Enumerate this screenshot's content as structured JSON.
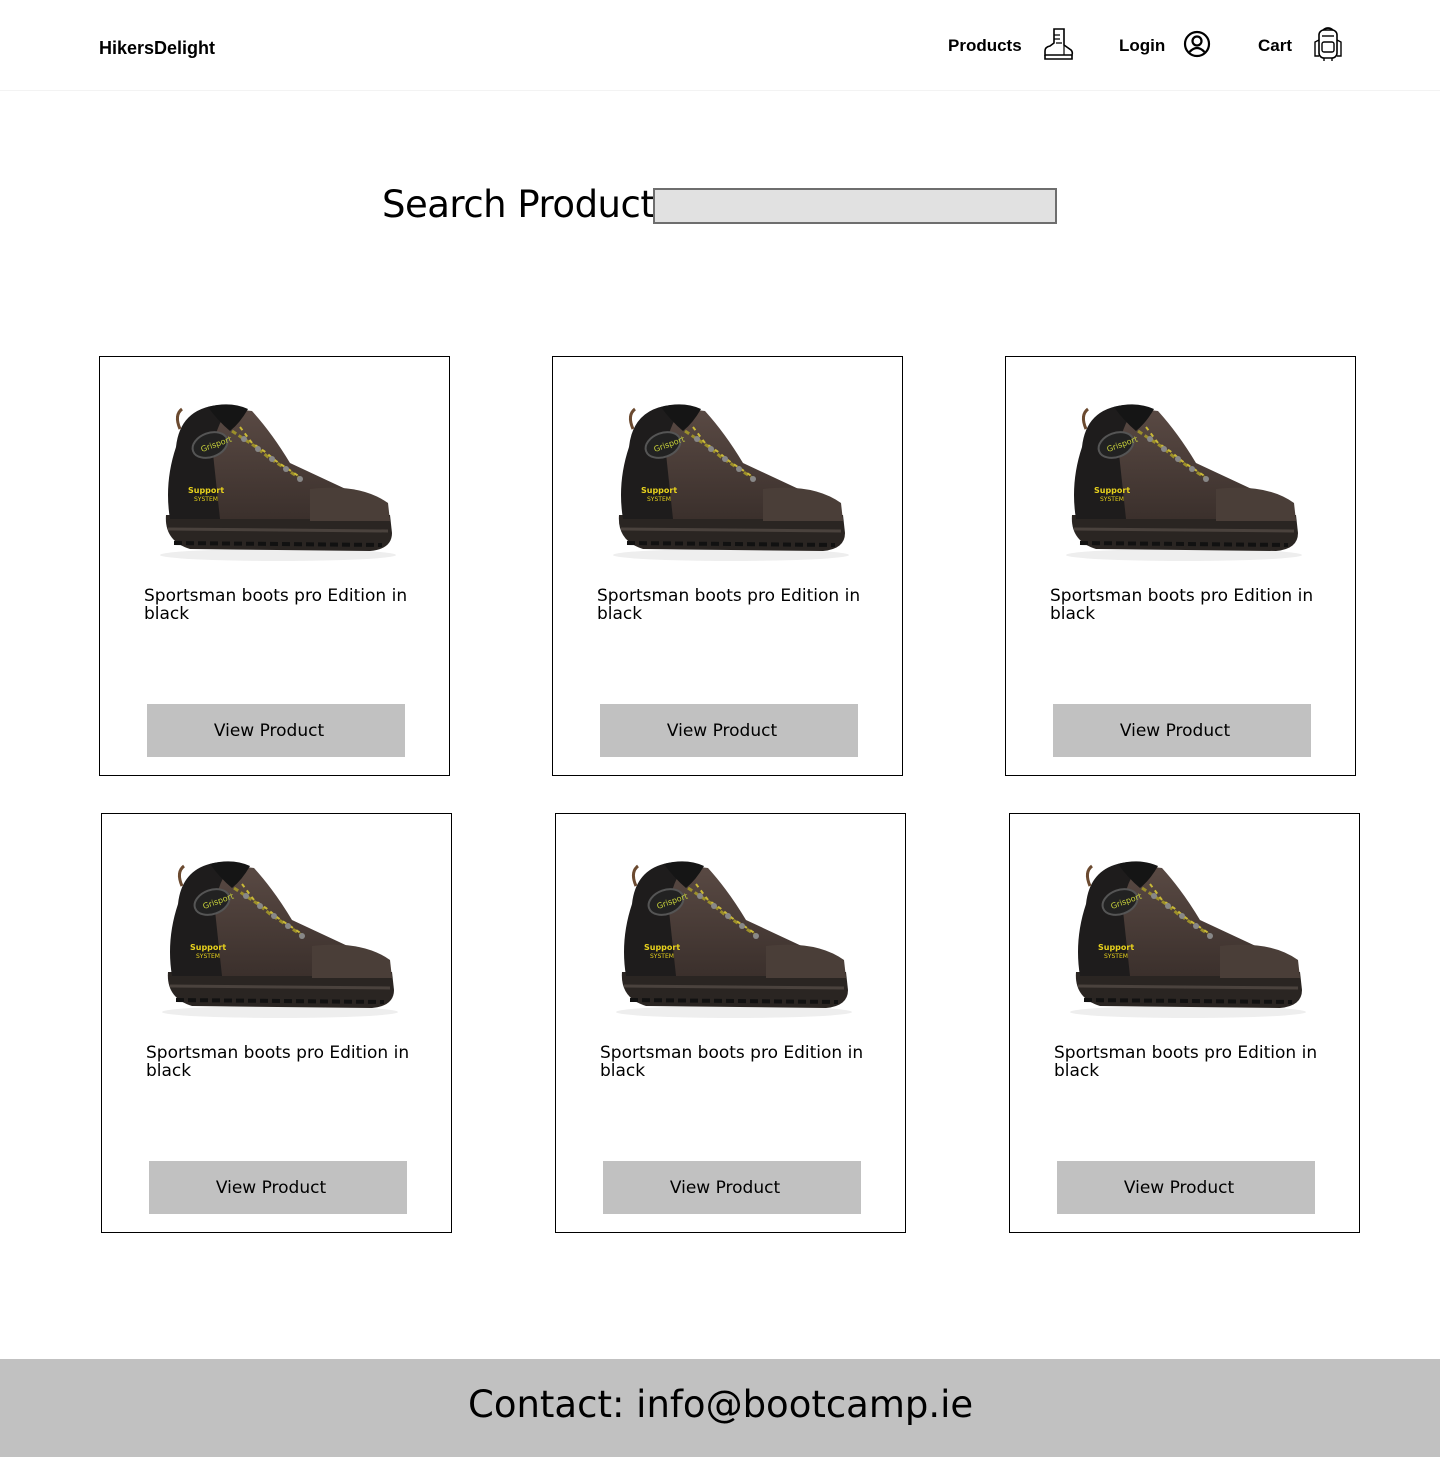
{
  "header": {
    "brand": "HikersDelight",
    "nav": {
      "products": {
        "label": "Products",
        "icon": "boot-icon"
      },
      "login": {
        "label": "Login",
        "icon": "user-circle-icon"
      },
      "cart": {
        "label": "Cart",
        "icon": "backpack-icon"
      }
    }
  },
  "search": {
    "label": "Search Product",
    "value": "",
    "placeholder": ""
  },
  "products": [
    {
      "name": "Sportsman boots pro Edition in black",
      "button": "View Product"
    },
    {
      "name": "Sportsman boots pro Edition in black",
      "button": "View Product"
    },
    {
      "name": "Sportsman boots pro Edition in black",
      "button": "View Product"
    },
    {
      "name": "Sportsman boots pro Edition in black",
      "button": "View Product"
    },
    {
      "name": "Sportsman boots pro Edition in black",
      "button": "View Product"
    },
    {
      "name": "Sportsman boots pro Edition in black",
      "button": "View Product"
    }
  ],
  "footer": {
    "contact": "Contact: info@bootcamp.ie"
  },
  "colors": {
    "button_bg": "#c1c1c1",
    "footer_bg": "#c1c1c1",
    "search_bg": "#e1e1e1"
  }
}
